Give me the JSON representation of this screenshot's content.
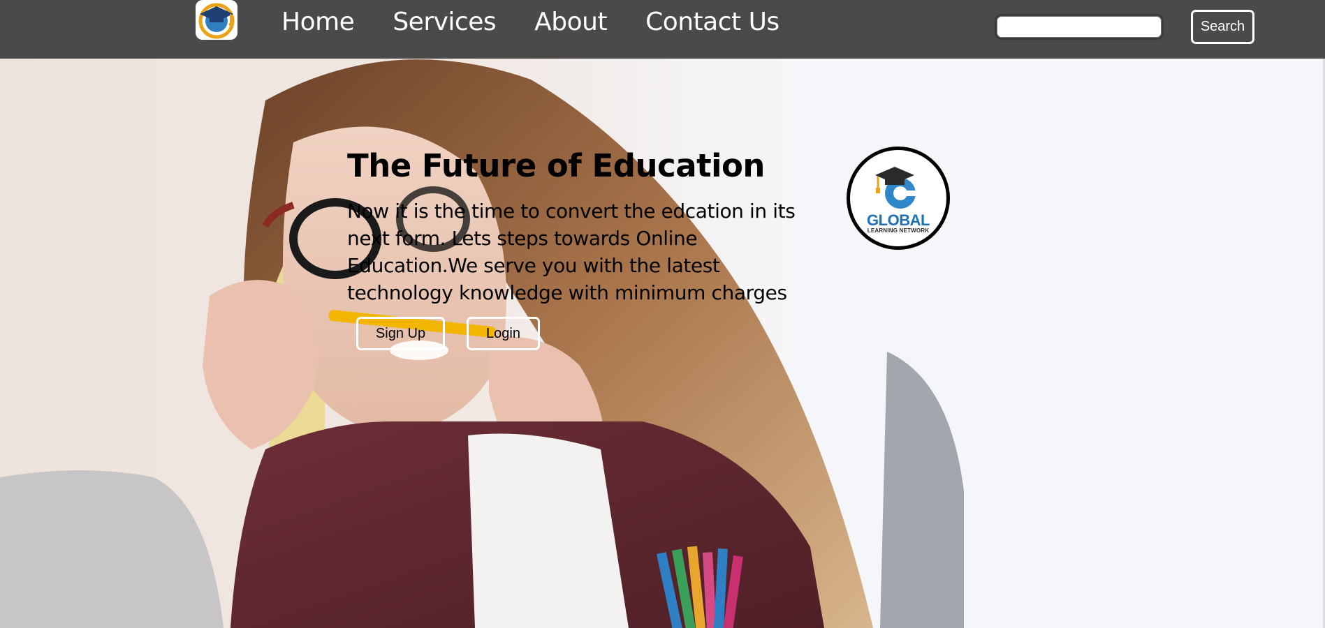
{
  "nav": {
    "logo_icon": "graduation-cap-logo",
    "links": [
      "Home",
      "Services",
      "About",
      "Contact Us"
    ],
    "search_placeholder": "",
    "search_button": "Search"
  },
  "hero": {
    "title": "The Future of Education",
    "text": "Now it is the time to convert the edcation in its next form. Lets steps towards Online Education.We serve you with the latest technology knowledge with minimum charges",
    "signup_label": "Sign Up",
    "login_label": "Login",
    "background_image": "woman-biting-pencil-photo"
  },
  "brand": {
    "name": "GLOBAL",
    "subtitle": "LEARNING NETWORK",
    "icon": "graduation-cap-globe-icon"
  },
  "colors": {
    "navbar": "#4a4a4a",
    "nav_text": "#ffffff",
    "brand_blue": "#1f6fb5",
    "cap_gold": "#e8a317"
  }
}
